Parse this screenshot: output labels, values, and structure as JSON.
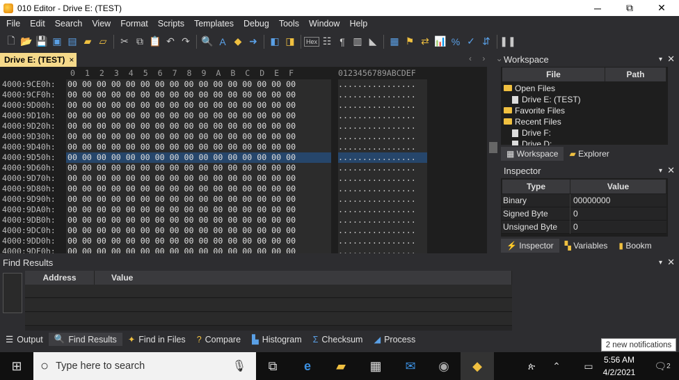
{
  "window": {
    "title": "010 Editor - Drive E: (TEST)",
    "minimize": "─",
    "maximize": "⧉",
    "close": "✕"
  },
  "menu": [
    "File",
    "Edit",
    "Search",
    "View",
    "Format",
    "Scripts",
    "Templates",
    "Debug",
    "Tools",
    "Window",
    "Help"
  ],
  "toolbar": {
    "hex_label": "Hex"
  },
  "doc_tab": {
    "label": "Drive E: (TEST)",
    "close": "×"
  },
  "hex": {
    "header_cols": "0  1  2  3  4  5  6  7  8  9  A  B  C  D  E  F",
    "header_ascii": "0123456789ABCDEF",
    "rows": [
      {
        "addr": "4000:9CE0h:",
        "bytes": "00 00 00 00 00 00 00 00 00 00 00 00 00 00 00 00",
        "ascii": "................"
      },
      {
        "addr": "4000:9CF0h:",
        "bytes": "00 00 00 00 00 00 00 00 00 00 00 00 00 00 00 00",
        "ascii": "................"
      },
      {
        "addr": "4000:9D00h:",
        "bytes": "00 00 00 00 00 00 00 00 00 00 00 00 00 00 00 00",
        "ascii": "................"
      },
      {
        "addr": "4000:9D10h:",
        "bytes": "00 00 00 00 00 00 00 00 00 00 00 00 00 00 00 00",
        "ascii": "................"
      },
      {
        "addr": "4000:9D20h:",
        "bytes": "00 00 00 00 00 00 00 00 00 00 00 00 00 00 00 00",
        "ascii": "................"
      },
      {
        "addr": "4000:9D30h:",
        "bytes": "00 00 00 00 00 00 00 00 00 00 00 00 00 00 00 00",
        "ascii": "................"
      },
      {
        "addr": "4000:9D40h:",
        "bytes": "00 00 00 00 00 00 00 00 00 00 00 00 00 00 00 00",
        "ascii": "................"
      },
      {
        "addr": "4000:9D50h:",
        "bytes": "00 00 00 00 00 00 00 00 00 00 00 00 00 00 00 00",
        "ascii": "................"
      },
      {
        "addr": "4000:9D60h:",
        "bytes": "00 00 00 00 00 00 00 00 00 00 00 00 00 00 00 00",
        "ascii": "................"
      },
      {
        "addr": "4000:9D70h:",
        "bytes": "00 00 00 00 00 00 00 00 00 00 00 00 00 00 00 00",
        "ascii": "................"
      },
      {
        "addr": "4000:9D80h:",
        "bytes": "00 00 00 00 00 00 00 00 00 00 00 00 00 00 00 00",
        "ascii": "................"
      },
      {
        "addr": "4000:9D90h:",
        "bytes": "00 00 00 00 00 00 00 00 00 00 00 00 00 00 00 00",
        "ascii": "................"
      },
      {
        "addr": "4000:9DA0h:",
        "bytes": "00 00 00 00 00 00 00 00 00 00 00 00 00 00 00 00",
        "ascii": "................"
      },
      {
        "addr": "4000:9DB0h:",
        "bytes": "00 00 00 00 00 00 00 00 00 00 00 00 00 00 00 00",
        "ascii": "................"
      },
      {
        "addr": "4000:9DC0h:",
        "bytes": "00 00 00 00 00 00 00 00 00 00 00 00 00 00 00 00",
        "ascii": "................"
      },
      {
        "addr": "4000:9DD0h:",
        "bytes": "00 00 00 00 00 00 00 00 00 00 00 00 00 00 00 00",
        "ascii": "................"
      },
      {
        "addr": "4000:9DE0h:",
        "bytes": "00 00 00 00 00 00 00 00 00 00 00 00 00 00 00 00",
        "ascii": "................"
      }
    ]
  },
  "workspace": {
    "title": "Workspace",
    "col_file": "File",
    "col_path": "Path",
    "tree": {
      "open_files": "Open Files",
      "open_item": "Drive E: (TEST)",
      "favorite_files": "Favorite Files",
      "recent_files": "Recent Files",
      "recent1": "Drive F:",
      "recent2": "Drive D:"
    },
    "tab_workspace": "Workspace",
    "tab_explorer": "Explorer"
  },
  "inspector": {
    "title": "Inspector",
    "col_type": "Type",
    "col_value": "Value",
    "rows": [
      {
        "type": "Binary",
        "value": "00000000"
      },
      {
        "type": "Signed Byte",
        "value": "0"
      },
      {
        "type": "Unsigned Byte",
        "value": "0"
      }
    ],
    "tab_inspector": "Inspector",
    "tab_variables": "Variables",
    "tab_bookmarks": "Bookm"
  },
  "find": {
    "title": "Find Results",
    "col_address": "Address",
    "col_value": "Value"
  },
  "bottom_tabs": [
    "Output",
    "Find Results",
    "Find in Files",
    "Compare",
    "Histogram",
    "Checksum",
    "Process"
  ],
  "notification": "2 new notifications",
  "taskbar": {
    "search_placeholder": "Type here to search",
    "time": "5:56 AM",
    "date": "4/2/2021",
    "notif_count": "2"
  }
}
